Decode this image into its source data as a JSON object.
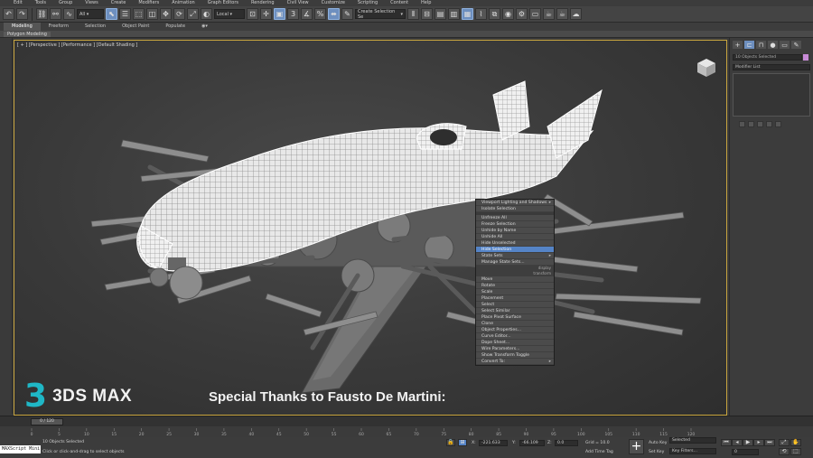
{
  "menu": {
    "items": [
      "Edit",
      "Tools",
      "Group",
      "Views",
      "Create",
      "Modifiers",
      "Animation",
      "Graph Editors",
      "Rendering",
      "Civil View",
      "Customize",
      "Scripting",
      "Content",
      "Help"
    ]
  },
  "toolbar": {
    "filter_value": "All",
    "refcoord_value": "Local",
    "selection_set_placeholder": "Create Selection Se"
  },
  "ribbon": {
    "tabs": [
      "Modeling",
      "Freeform",
      "Selection",
      "Object Paint",
      "Populate"
    ],
    "active_tab": "Modeling",
    "sub_label": "Polygon Modeling"
  },
  "viewport": {
    "label": "[ + ] [Perspective ] [Performance ] [Default Shading ]"
  },
  "context_menu": {
    "items": [
      {
        "label": "Viewport Lighting and Shadows",
        "arrow": true
      },
      {
        "label": "Isolate Selection"
      },
      {
        "sep": true
      },
      {
        "label": "Unfreeze All"
      },
      {
        "label": "Freeze Selection"
      },
      {
        "label": "Unhide by Name"
      },
      {
        "label": "Unhide All"
      },
      {
        "label": "Hide Unselected"
      },
      {
        "label": "Hide Selection",
        "highlight": true
      },
      {
        "label": "State Sets",
        "arrow": true
      },
      {
        "label": "Manage State Sets..."
      },
      {
        "header": "display"
      },
      {
        "header": "transform"
      },
      {
        "label": "Move"
      },
      {
        "label": "Rotate"
      },
      {
        "label": "Scale"
      },
      {
        "label": "Placement"
      },
      {
        "label": "Select"
      },
      {
        "label": "Select Similar"
      },
      {
        "label": "Place Pivot Surface"
      },
      {
        "label": "Clone"
      },
      {
        "label": "Object Properties..."
      },
      {
        "label": "Curve Editor..."
      },
      {
        "label": "Dope Sheet..."
      },
      {
        "label": "Wire Parameters..."
      },
      {
        "label": "Show Transform Toggle"
      },
      {
        "label": "Convert To:",
        "arrow": true
      }
    ]
  },
  "branding": {
    "logo_number": "3",
    "product": "3DS MAX",
    "credit": "Special Thanks to Fausto De Martini:"
  },
  "command_panel": {
    "tabs": [
      "+",
      "⊏",
      "⊓",
      "●",
      "▭",
      "✎"
    ],
    "object_field": "10 Objects Selected",
    "modifier_list": "Modifier List",
    "swatch_color": "#c78ad6"
  },
  "timeline": {
    "slider": "0 / 120",
    "ticks": [
      "0",
      "5",
      "10",
      "15",
      "20",
      "25",
      "30",
      "35",
      "40",
      "45",
      "50",
      "55",
      "60",
      "65",
      "70",
      "75",
      "80",
      "85",
      "90",
      "95",
      "100",
      "105",
      "110",
      "115",
      "120"
    ]
  },
  "status": {
    "maxscript": "MAXScript Mini",
    "line1": "10 Objects Selected",
    "line2": "Click or click-and-drag to select objects",
    "x_label": "X:",
    "x_value": "-221.633",
    "y_label": "Y:",
    "y_value": "-66.109",
    "z_label": "Z:",
    "z_value": "0.0",
    "grid": "Grid = 10.0",
    "add_time_tag": "Add Time Tag",
    "autokey": "Auto Key",
    "autokey_value": "Selected",
    "setkey": "Set Key",
    "key_filters": "Key Filters...",
    "frame": "0"
  },
  "colors": {
    "accent": "#6d8fbf",
    "highlight": "#5584c7",
    "viewport_border": "#c9a63f",
    "logo": "#1fb7c6"
  }
}
